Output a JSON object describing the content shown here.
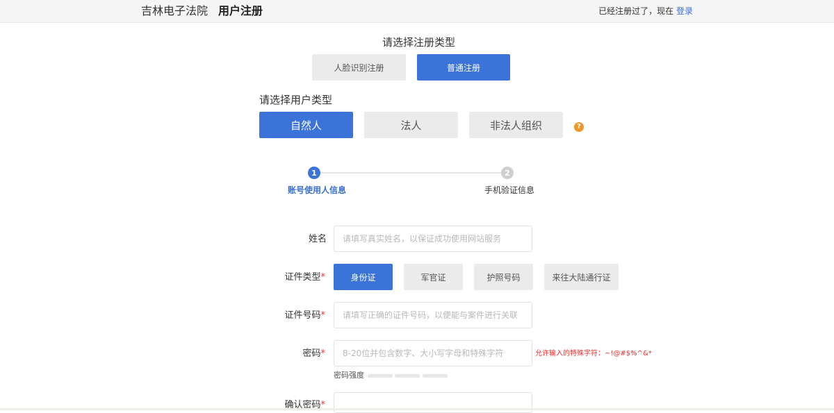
{
  "header": {
    "court_name": "吉林电子法院",
    "page_title": "用户注册",
    "login_hint": "已经注册过了，现在",
    "login_link": "登录"
  },
  "registration_type": {
    "title": "请选择注册类型",
    "options": [
      {
        "label": "人脸识别注册",
        "selected": false
      },
      {
        "label": "普通注册",
        "selected": true
      }
    ]
  },
  "user_type": {
    "title": "请选择用户类型",
    "options": [
      {
        "label": "自然人",
        "selected": true
      },
      {
        "label": "法人",
        "selected": false
      },
      {
        "label": "非法人组织",
        "selected": false
      }
    ],
    "help_icon": "?"
  },
  "steps": [
    {
      "number": "1",
      "label": "账号使用人信息",
      "active": true
    },
    {
      "number": "2",
      "label": "手机验证信息",
      "active": false
    }
  ],
  "form": {
    "name": {
      "label": "姓名",
      "placeholder": "请填写真实姓名，以保证成功使用网站服务",
      "value": ""
    },
    "id_type": {
      "label": "证件类型",
      "required_mark": "*",
      "options": [
        {
          "label": "身份证",
          "selected": true
        },
        {
          "label": "军官证",
          "selected": false
        },
        {
          "label": "护照号码",
          "selected": false
        },
        {
          "label": "来往大陆通行证",
          "selected": false
        }
      ]
    },
    "id_number": {
      "label": "证件号码",
      "required_mark": "*",
      "placeholder": "请填写正确的证件号码，以便能与案件进行关联",
      "value": ""
    },
    "password": {
      "label": "密码",
      "required_mark": "*",
      "placeholder": "8-20位并包含数字、大小写字母和特殊字符",
      "value": "",
      "hint": "允许输入的特殊字符：~!@#$%^&*",
      "strength_label": "密码强度"
    },
    "confirm_password": {
      "label": "确认密码",
      "required_mark": "*",
      "value": ""
    }
  },
  "colors": {
    "primary": "#3b73d8",
    "button_gray": "#ebebeb",
    "error": "#e8312f",
    "help": "#f0962a"
  }
}
